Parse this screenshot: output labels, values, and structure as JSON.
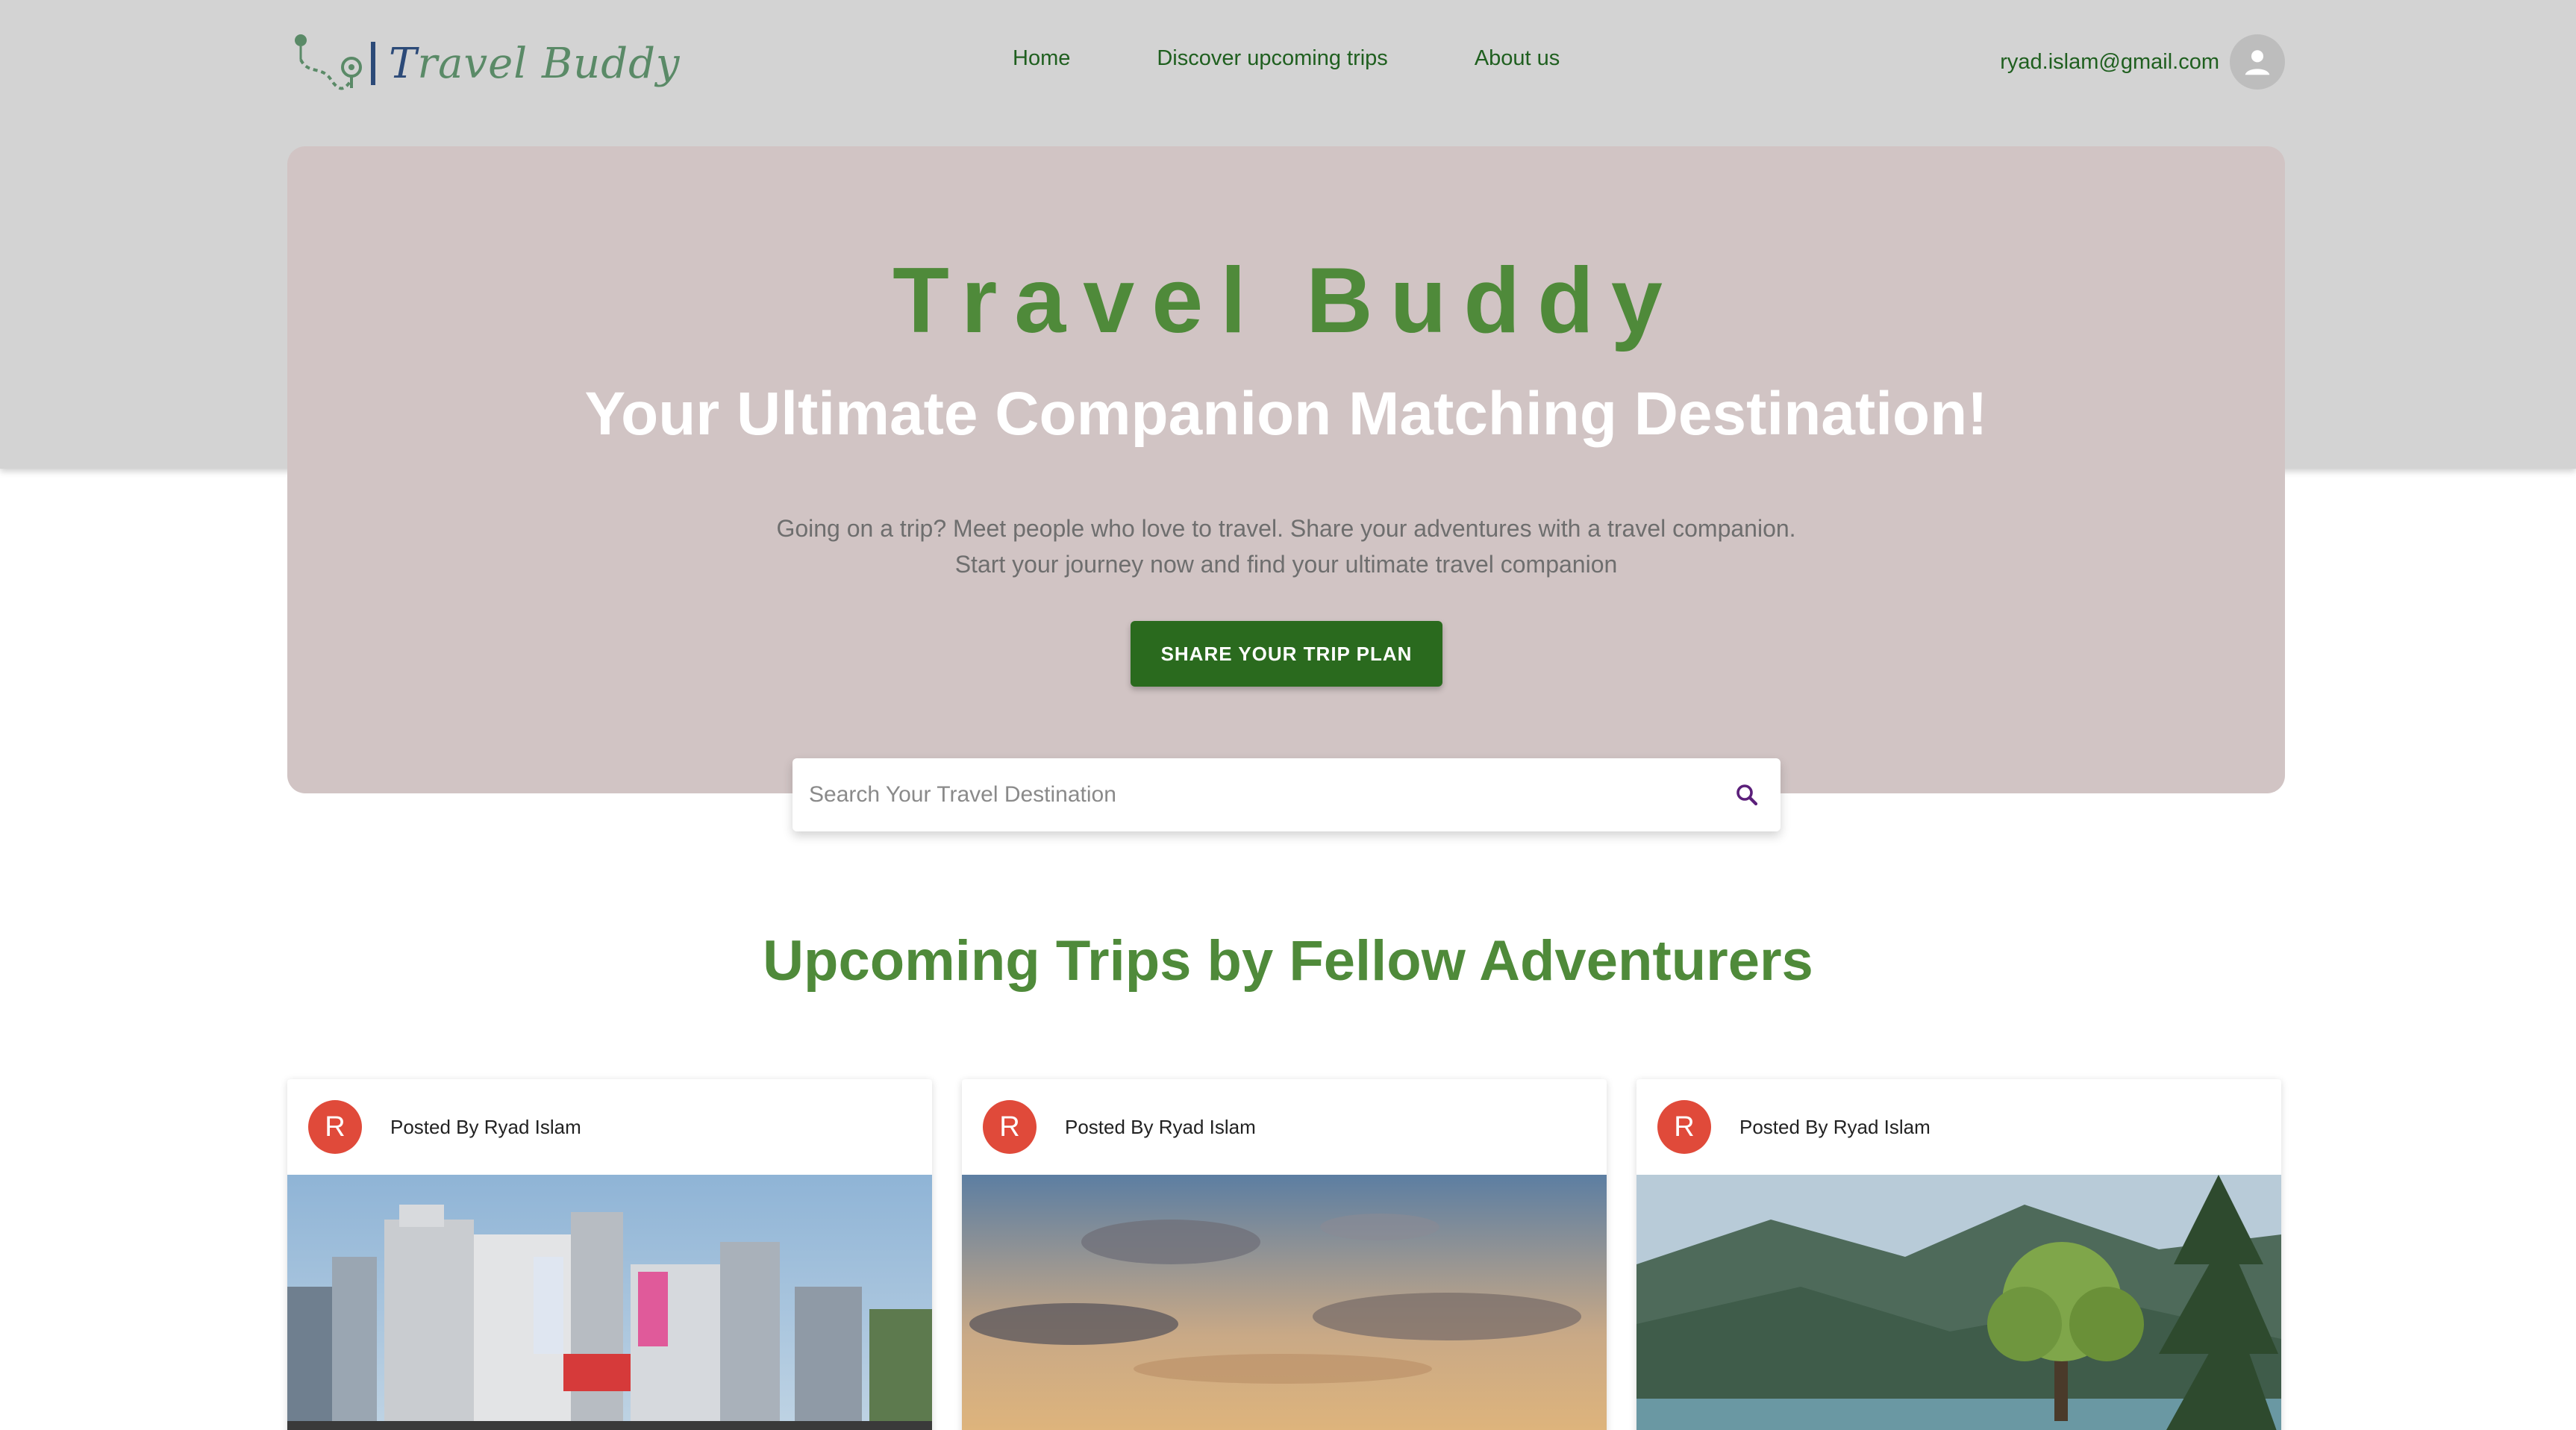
{
  "logo": {
    "text_prefix": "T",
    "text_rest": "ravel Buddy"
  },
  "nav": {
    "items": [
      "Home",
      "Discover upcoming trips",
      "About us"
    ]
  },
  "user": {
    "email": "ryad.islam@gmail.com"
  },
  "hero": {
    "title": "Travel Buddy",
    "subtitle": "Your Ultimate Companion Matching Destination!",
    "description_line1": "Going on a trip? Meet people who love to travel. Share your adventures with a travel companion.",
    "description_line2": "Start your journey now and find your ultimate travel companion",
    "cta_label": "SHARE YOUR TRIP PLAN"
  },
  "search": {
    "placeholder": "Search Your Travel Destination"
  },
  "section": {
    "title": "Upcoming Trips by Fellow Adventurers"
  },
  "trips": [
    {
      "avatar_initial": "R",
      "posted_by": "Posted By Ryad Islam",
      "image": "city-street"
    },
    {
      "avatar_initial": "R",
      "posted_by": "Posted By Ryad Islam",
      "image": "sunset-sky"
    },
    {
      "avatar_initial": "R",
      "posted_by": "Posted By Ryad Islam",
      "image": "mountain-lake"
    }
  ],
  "colors": {
    "brand_green": "#4f8a3a",
    "nav_green": "#1f5f1f",
    "cta_green": "#2a6a1e",
    "hero_bg": "#d1c4c4",
    "header_bg": "#d3d3d3",
    "avatar_red": "#e04a3a",
    "search_icon": "#5b1f7a"
  }
}
